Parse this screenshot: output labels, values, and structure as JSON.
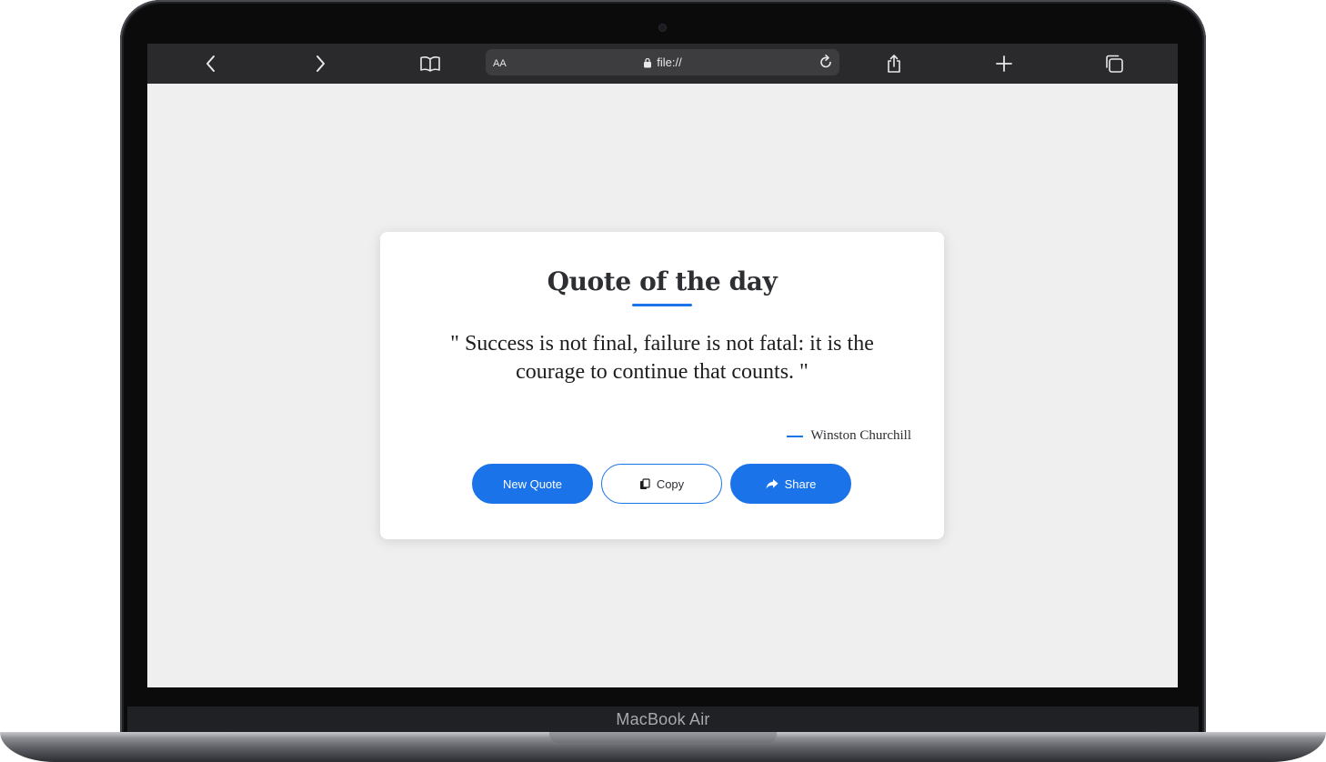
{
  "device": {
    "model_label": "MacBook Air"
  },
  "browser": {
    "reader_label": "AA",
    "url": "file://",
    "icons": {
      "back": "chevron-left-icon",
      "forward": "chevron-right-icon",
      "bookmarks": "book-icon",
      "lock": "lock-icon",
      "reload": "reload-icon",
      "share": "share-icon",
      "new_tab": "plus-icon",
      "tabs": "tabs-icon"
    }
  },
  "card": {
    "title": "Quote of the day",
    "quote": "\" Success is not final, failure is not fatal: it is the courage to continue that counts. \"",
    "author": "Winston Churchill",
    "buttons": {
      "new_quote": "New Quote",
      "copy": "Copy",
      "share": "Share"
    }
  },
  "colors": {
    "accent": "#1a73e8",
    "page_background": "#efefef",
    "card_background": "#ffffff",
    "toolbar": "#2a2a2c"
  }
}
